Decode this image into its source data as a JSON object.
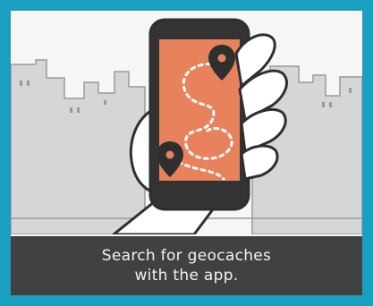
{
  "caption": {
    "line1": "Search for geocaches",
    "line2": "with the app."
  },
  "colors": {
    "border": "#1a9fbe",
    "panel_bg": "#f6f6f5",
    "caption_bg": "#414142",
    "caption_text": "#f2f2f2",
    "screen": "#e8825c",
    "phone_body": "#333333",
    "skyline": "#d6d6d6",
    "skyline_stroke": "#9a9a9a",
    "pin": "#2f2f2f"
  },
  "icons": [
    "phone-icon",
    "hand-icon",
    "map-pin-icon",
    "dotted-route-icon",
    "city-skyline-icon"
  ]
}
